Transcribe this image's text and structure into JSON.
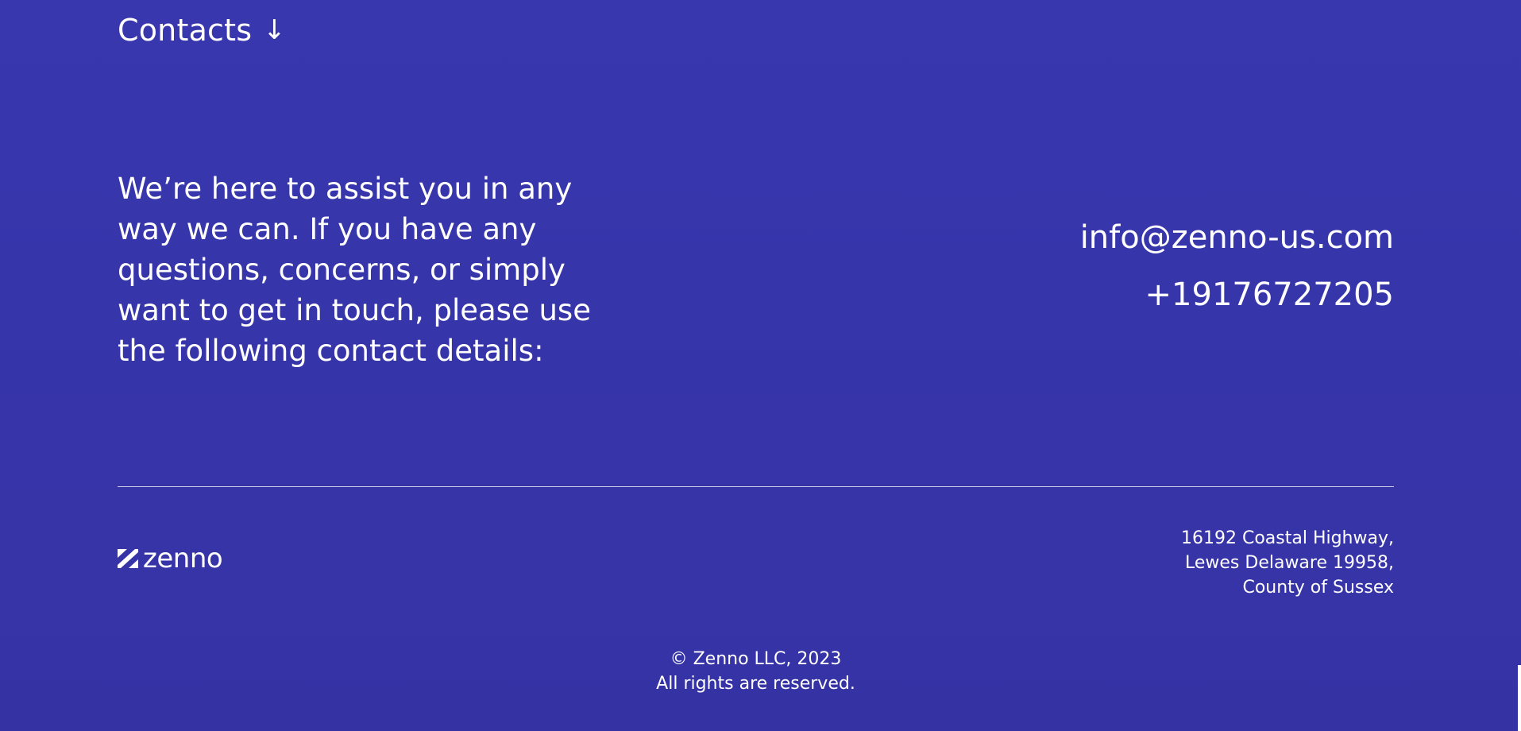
{
  "contacts": {
    "heading": "Contacts",
    "arrow_icon": "↓",
    "intro": "We’re here to assist you in any way we can. If you have any questions, concerns, or simply want to get in touch, please use the following contact details:",
    "email": "info@zenno-us.com",
    "phone": "+19176727205"
  },
  "footer": {
    "logo_text": "zenno",
    "address_lines": [
      "16192 Coastal Highway,",
      "Lewes Delaware 19958,",
      "County of Sussex"
    ],
    "copyright_lines": [
      "© Zenno LLC, 2023",
      "All rights are reserved."
    ]
  },
  "colors": {
    "background": "#3937ab",
    "text": "#ffffff"
  }
}
